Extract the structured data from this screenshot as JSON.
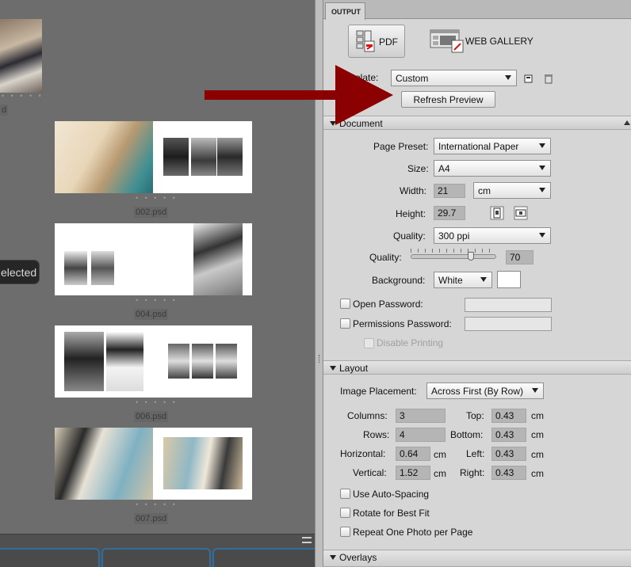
{
  "browser": {
    "selected_badge": "elected",
    "first_thumb_label": "d",
    "pages": [
      {
        "file": "002.psd"
      },
      {
        "file": "004.psd"
      },
      {
        "file": "006.psd"
      },
      {
        "file": "007.psd"
      }
    ],
    "page_dots": "• • • • •"
  },
  "output": {
    "tab": "OUTPUT",
    "pdf_button": "PDF",
    "web_gallery_button": "WEB GALLERY",
    "template_label": "mplate:",
    "template_value": "Custom",
    "refresh_button": "Refresh Preview"
  },
  "document": {
    "section": "Document",
    "page_preset_label": "Page Preset:",
    "page_preset_value": "International Paper",
    "size_label": "Size:",
    "size_value": "A4",
    "width_label": "Width:",
    "width_value": "21",
    "unit_value": "cm",
    "height_label": "Height:",
    "height_value": "29.7",
    "quality_select_label": "Quality:",
    "quality_select_value": "300 ppi",
    "quality_slider_label": "Quality:",
    "quality_slider_value": "70",
    "quality_slider_fraction": 0.7,
    "background_label": "Background:",
    "background_value": "White",
    "open_password_label": "Open Password:",
    "permissions_password_label": "Permissions Password:",
    "disable_printing_label": "Disable Printing"
  },
  "layout": {
    "section": "Layout",
    "image_placement_label": "Image Placement:",
    "image_placement_value": "Across First (By Row)",
    "columns_label": "Columns:",
    "columns_value": "3",
    "rows_label": "Rows:",
    "rows_value": "4",
    "horizontal_label": "Horizontal:",
    "horizontal_value": "0.64",
    "vertical_label": "Vertical:",
    "vertical_value": "1.52",
    "top_label": "Top:",
    "top_value": "0.43",
    "bottom_label": "Bottom:",
    "bottom_value": "0.43",
    "left_label": "Left:",
    "left_value": "0.43",
    "right_label": "Right:",
    "right_value": "0.43",
    "unit": "cm",
    "auto_spacing_label": "Use Auto-Spacing",
    "rotate_label": "Rotate for Best Fit",
    "repeat_label": "Repeat One Photo per Page"
  },
  "overlays": {
    "section": "Overlays"
  },
  "colors": {
    "arrow": "#8b0000",
    "panel": "#d6d6d6",
    "browser_bg": "#6d6d6d"
  }
}
